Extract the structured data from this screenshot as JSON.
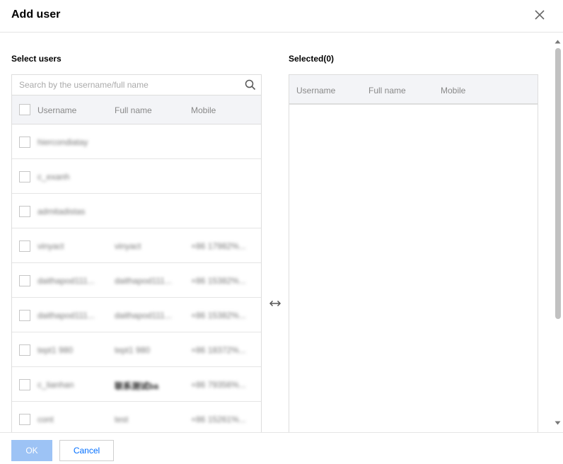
{
  "dialog": {
    "title": "Add user",
    "ok_label": "OK",
    "cancel_label": "Cancel"
  },
  "left": {
    "label": "Select users",
    "search_placeholder": "Search by the username/full name",
    "columns": [
      "Username",
      "Full name",
      "Mobile"
    ],
    "rows": [
      {
        "username": "hiercondiatay",
        "fullname": "",
        "mobile": ""
      },
      {
        "username": "c_exanh",
        "fullname": "",
        "mobile": ""
      },
      {
        "username": "admitadistas",
        "fullname": "",
        "mobile": ""
      },
      {
        "username": "vinyact",
        "fullname": "vinyact",
        "mobile": "+86 17982%..."
      },
      {
        "username": "daithapod111...",
        "fullname": "daithapod111...",
        "mobile": "+86 15382%..."
      },
      {
        "username": "daithapod111...",
        "fullname": "daithapod111...",
        "mobile": "+86 15382%..."
      },
      {
        "username": "tept1 980",
        "fullname": "tept1 980",
        "mobile": "+86 18372%..."
      },
      {
        "username": "c_lianhan",
        "fullname": "联系测试ba",
        "mobile": "+86 79356%..."
      },
      {
        "username": "cont",
        "fullname": "test",
        "mobile": "+86 15261%..."
      }
    ]
  },
  "right": {
    "label": "Selected(0)",
    "columns": [
      "Username",
      "Full name",
      "Mobile"
    ]
  },
  "colors": {
    "accent": "#006eff",
    "ok_disabled": "#9dc3f5",
    "header_bg": "#f3f4f7",
    "border": "#dddddd"
  },
  "icons": {
    "close": "close-icon",
    "search": "search-icon",
    "swap": "swap-arrows-icon"
  }
}
